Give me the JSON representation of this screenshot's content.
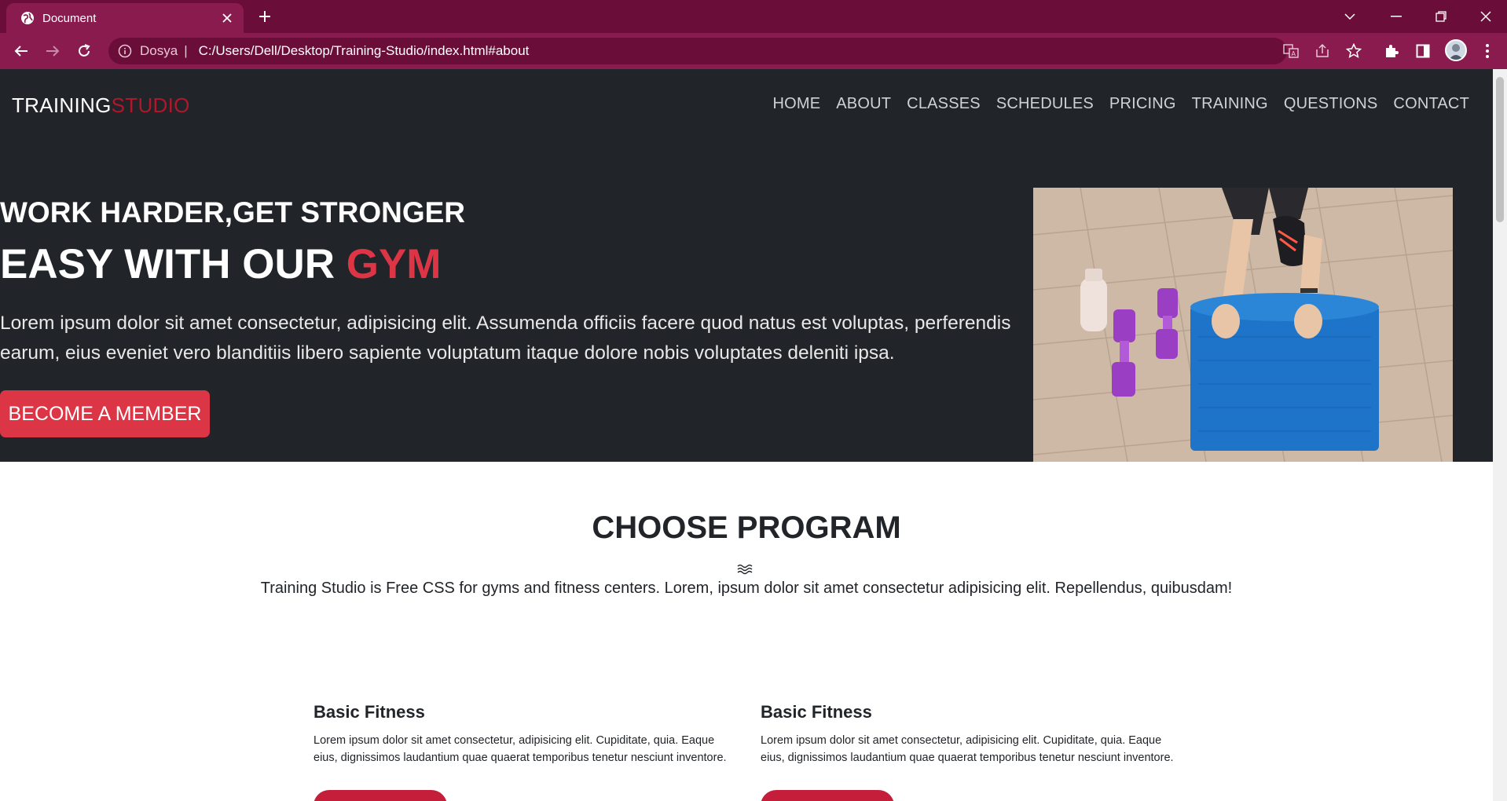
{
  "browser": {
    "tab_title": "Document",
    "address_site_label": "Dosya",
    "address_url": "C:/Users/Dell/Desktop/Training-Studio/index.html#about"
  },
  "nav": {
    "logo_main": "TRAINING",
    "logo_accent": "STUDIO",
    "items": [
      "HOME",
      "ABOUT",
      "CLASSES",
      "SCHEDULES",
      "PRICING",
      "TRAINING",
      "QUESTIONS",
      "CONTACT"
    ]
  },
  "hero": {
    "subtitle": "WORK HARDER,GET STRONGER",
    "title_main": "EASY WITH OUR",
    "title_accent": "GYM",
    "lead": "Lorem ipsum dolor sit amet consectetur, adipisicing elit. Assumenda officiis facere quod natus est voluptas, perferendis earum, eius eveniet vero blanditiis libero sapiente voluptatum itaque dolore nobis voluptates deleniti ipsa.",
    "cta_label": "BECOME A MEMBER"
  },
  "programs": {
    "title": "CHOOSE PROGRAM",
    "description": "Training Studio is Free CSS for gyms and fitness centers. Lorem, ipsum dolor sit amet consectetur adipisicing elit. Repellendus, quibusdam!",
    "cards": [
      {
        "title": "Basic Fitness",
        "text": "Lorem ipsum dolor sit amet consectetur, adipisicing elit. Cupiditate, quia. Eaque eius, dignissimos laudantium quae quaerat temporibus tenetur nesciunt inventore."
      },
      {
        "title": "Basic Fitness",
        "text": "Lorem ipsum dolor sit amet consectetur, adipisicing elit. Cupiditate, quia. Eaque eius, dignissimos laudantium quae quaerat temporibus tenetur nesciunt inventore."
      }
    ]
  },
  "colors": {
    "browser_frame": "#6a0d38",
    "browser_toolbar": "#8a1b4e",
    "hero_bg": "#212529",
    "accent_red": "#dc3545",
    "logo_red": "#b3162b"
  },
  "icons": [
    "globe-icon",
    "close-icon",
    "plus-icon",
    "chevron-down-icon",
    "minimize-icon",
    "restore-icon",
    "back-icon",
    "forward-icon",
    "reload-icon",
    "info-icon",
    "translate-icon",
    "share-icon",
    "star-icon",
    "extensions-icon",
    "sidepanel-icon",
    "menu-icon",
    "wave-icon"
  ]
}
